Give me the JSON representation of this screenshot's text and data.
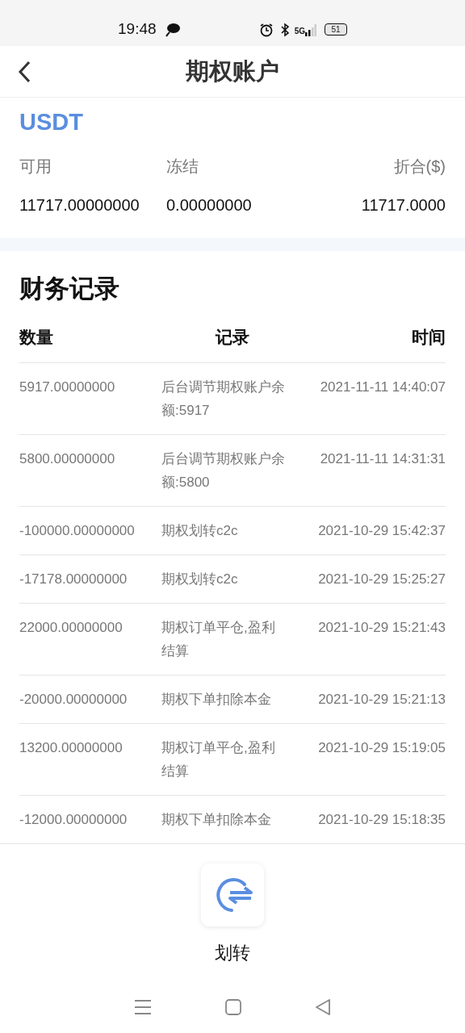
{
  "status_bar": {
    "time": "19:48",
    "network": "5G",
    "battery": "51"
  },
  "header": {
    "title": "期权账户"
  },
  "account": {
    "currency": "USDT",
    "columns": [
      {
        "label": "可用",
        "value": "11717.00000000"
      },
      {
        "label": "冻结",
        "value": "0.00000000"
      },
      {
        "label": "折合($)",
        "value": "11717.0000"
      }
    ]
  },
  "records": {
    "title": "财务记录",
    "columns": [
      "数量",
      "记录",
      "时间"
    ],
    "rows": [
      {
        "amount": "5917.00000000",
        "record": "后台调节期权账户余额:5917",
        "time": "2021-11-11 14:40:07"
      },
      {
        "amount": "5800.00000000",
        "record": "后台调节期权账户余额:5800",
        "time": "2021-11-11 14:31:31"
      },
      {
        "amount": "-100000.00000000",
        "record": "期权划转c2c",
        "time": "2021-10-29 15:42:37"
      },
      {
        "amount": "-17178.00000000",
        "record": "期权划转c2c",
        "time": "2021-10-29 15:25:27"
      },
      {
        "amount": "22000.00000000",
        "record": "期权订单平仓,盈利结算",
        "time": "2021-10-29 15:21:43"
      },
      {
        "amount": "-20000.00000000",
        "record": "期权下单扣除本金",
        "time": "2021-10-29 15:21:13"
      },
      {
        "amount": "13200.00000000",
        "record": "期权订单平仓,盈利结算",
        "time": "2021-10-29 15:19:05"
      },
      {
        "amount": "-12000.00000000",
        "record": "期权下单扣除本金",
        "time": "2021-10-29 15:18:35"
      }
    ]
  },
  "bottom_action": {
    "label": "划转"
  }
}
